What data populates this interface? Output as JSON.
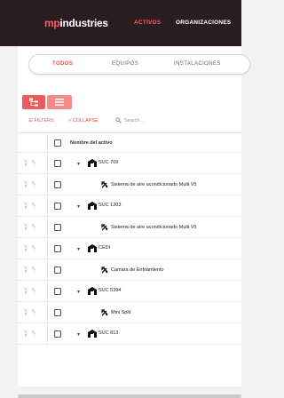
{
  "header": {
    "brand_prefix": "mp",
    "brand_name": "industries",
    "nav": [
      {
        "label": "ACTIVOS",
        "active": true
      },
      {
        "label": "ORGANIZACIONES",
        "active": false
      }
    ]
  },
  "tabs": [
    {
      "label": "TODOS",
      "active": true
    },
    {
      "label": "EQUIPOS",
      "active": false
    },
    {
      "label": "INSTALACIONES",
      "active": false
    }
  ],
  "toolbar": {
    "filters_label": "FILTERS",
    "collapse_label": "COLLAPSE",
    "search_placeholder": "Search..."
  },
  "table": {
    "column_header": "Nombre del activo",
    "rows": [
      {
        "type": "location",
        "label": "SUC 709"
      },
      {
        "type": "asset",
        "label": "Sistema de aire acondicionado Multi V5"
      },
      {
        "type": "location",
        "label": "SUC 1203"
      },
      {
        "type": "asset",
        "label": "Sistema de aire acondicionado Multi V5"
      },
      {
        "type": "location",
        "label": "CEDI"
      },
      {
        "type": "asset",
        "label": "Camara de Enfriamiento"
      },
      {
        "type": "location",
        "label": "SUC 5394"
      },
      {
        "type": "asset",
        "label": "Mini Split"
      },
      {
        "type": "location",
        "label": "SUC 813"
      }
    ]
  },
  "colors": {
    "topbar_bg": "#2a1d22",
    "accent": "#ff5a5f",
    "toggle": "#f05a5a"
  }
}
